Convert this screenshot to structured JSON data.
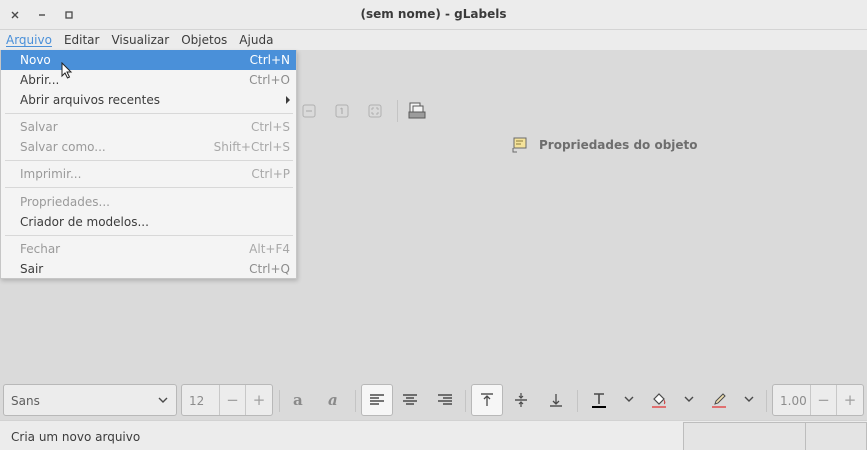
{
  "window": {
    "title": "(sem nome) - gLabels"
  },
  "menubar": {
    "items": [
      {
        "label": "Arquivo"
      },
      {
        "label": "Editar"
      },
      {
        "label": "Visualizar"
      },
      {
        "label": "Objetos"
      },
      {
        "label": "Ajuda"
      }
    ]
  },
  "file_menu": {
    "novo": {
      "label": "Novo",
      "accel": "Ctrl+N"
    },
    "abrir": {
      "label": "Abrir...",
      "accel": "Ctrl+O"
    },
    "recentes": {
      "label": "Abrir arquivos recentes"
    },
    "salvar": {
      "label": "Salvar",
      "accel": "Ctrl+S"
    },
    "salvar_como": {
      "label": "Salvar como...",
      "accel": "Shift+Ctrl+S"
    },
    "imprimir": {
      "label": "Imprimir...",
      "accel": "Ctrl+P"
    },
    "propriedades": {
      "label": "Propriedades..."
    },
    "criador": {
      "label": "Criador de modelos..."
    },
    "fechar": {
      "label": "Fechar",
      "accel": "Alt+F4"
    },
    "sair": {
      "label": "Sair",
      "accel": "Ctrl+Q"
    }
  },
  "object_panel": {
    "title": "Propriedades do objeto"
  },
  "format_bar": {
    "font_family": "Sans",
    "font_size": "12",
    "line_width": "1.00",
    "minus": "−",
    "plus": "+"
  },
  "status": {
    "message": "Cria um novo arquivo"
  },
  "colors": {
    "accent": "#4a90d9",
    "background": "#dadada",
    "menu_bg": "#f4f4f4"
  }
}
